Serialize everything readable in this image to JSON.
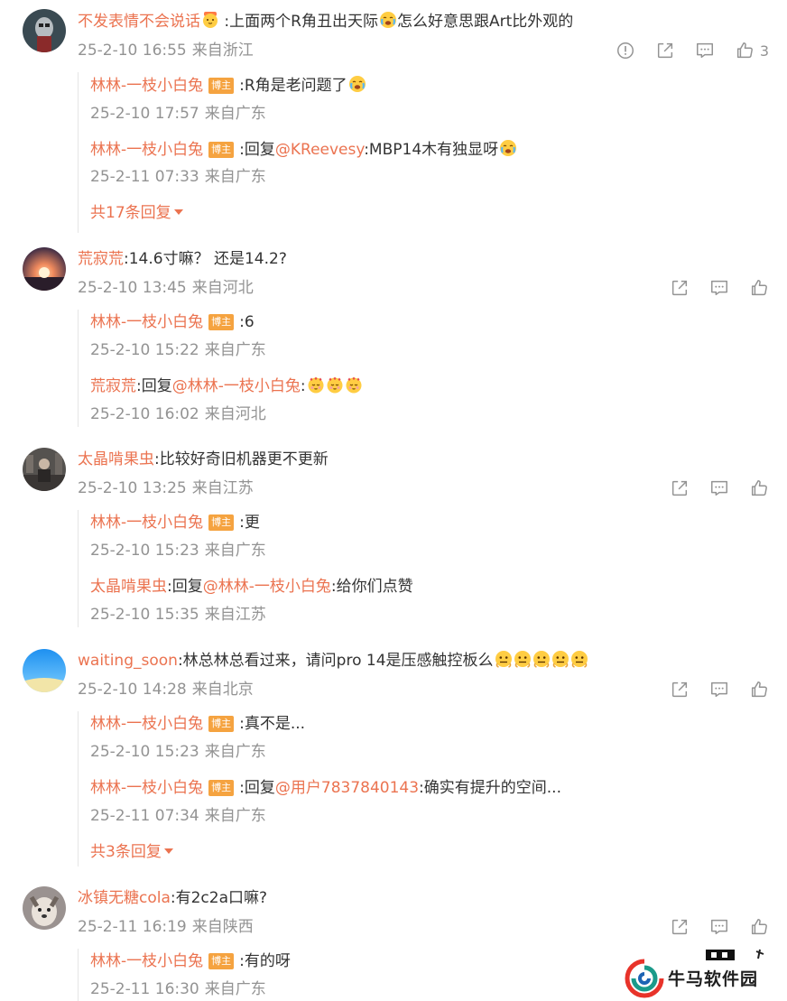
{
  "threads": [
    {
      "user": "不发表情不会说话",
      "text": ":上面两个R角丑出天际",
      "text2": "怎么好意思跟Art比外观的",
      "time": "25-2-10 16:55",
      "location": "来自浙江",
      "likes": "3",
      "replies": [
        {
          "user": "林林-一枝小白兔",
          "badge": "博主",
          "text": ":R角是老问题了",
          "time": "25-2-10 17:57",
          "location": "来自广东"
        },
        {
          "user": "林林-一枝小白兔",
          "badge": "博主",
          "text_pre": ":回复",
          "mention": "@KReevesy",
          "text": ":MBP14木有独显呀",
          "time": "25-2-11 07:33",
          "location": "来自广东"
        }
      ],
      "more": "共17条回复"
    },
    {
      "user": "荒寂荒",
      "text": ":14.6寸嘛？ 还是14.2?",
      "time": "25-2-10 13:45",
      "location": "来自河北",
      "replies": [
        {
          "user": "林林-一枝小白兔",
          "badge": "博主",
          "text": ":6",
          "time": "25-2-10 15:22",
          "location": "来自广东"
        },
        {
          "user": "荒寂荒",
          "text_pre": ":回复",
          "mention": "@林林-一枝小白兔",
          "text": ":",
          "time": "25-2-10 16:02",
          "location": "来自河北"
        }
      ]
    },
    {
      "user": "太晶啃果虫",
      "text": ":比较好奇旧机器更不更新",
      "time": "25-2-10 13:25",
      "location": "来自江苏",
      "replies": [
        {
          "user": "林林-一枝小白兔",
          "badge": "博主",
          "text": ":更",
          "time": "25-2-10 15:23",
          "location": "来自广东"
        },
        {
          "user": "太晶啃果虫",
          "text_pre": ":回复",
          "mention": "@林林-一枝小白兔",
          "text": ":给你们点赞",
          "time": "25-2-10 15:35",
          "location": "来自江苏"
        }
      ]
    },
    {
      "user": "waiting_soon",
      "text": ":林总林总看过来，请问pro 14是压感触控板么",
      "time": "25-2-10 14:28",
      "location": "来自北京",
      "replies": [
        {
          "user": "林林-一枝小白兔",
          "badge": "博主",
          "text": ":真不是...",
          "time": "25-2-10 15:23",
          "location": "来自广东"
        },
        {
          "user": "林林-一枝小白兔",
          "badge": "博主",
          "text_pre": ":回复",
          "mention": "@用户7837840143",
          "text": ":确实有提升的空间...",
          "time": "25-2-11 07:34",
          "location": "来自广东"
        }
      ],
      "more": "共3条回复"
    },
    {
      "user": "冰镇无糖cola",
      "text": ":有2c2a口嘛?",
      "time": "25-2-11 16:19",
      "location": "来自陕西",
      "replies": [
        {
          "user": "林林-一枝小白兔",
          "badge": "博主",
          "text": ":有的呀",
          "time": "25-2-11 16:30",
          "location": "来自广东"
        }
      ]
    }
  ],
  "watermark": {
    "text": "牛马软件园"
  },
  "icons": {
    "report": "report-icon",
    "share": "share-icon",
    "comment": "comment-icon",
    "like": "like-icon"
  },
  "colors": {
    "username": "#eb7350",
    "meta": "#939393",
    "badge": "#f5a340"
  }
}
